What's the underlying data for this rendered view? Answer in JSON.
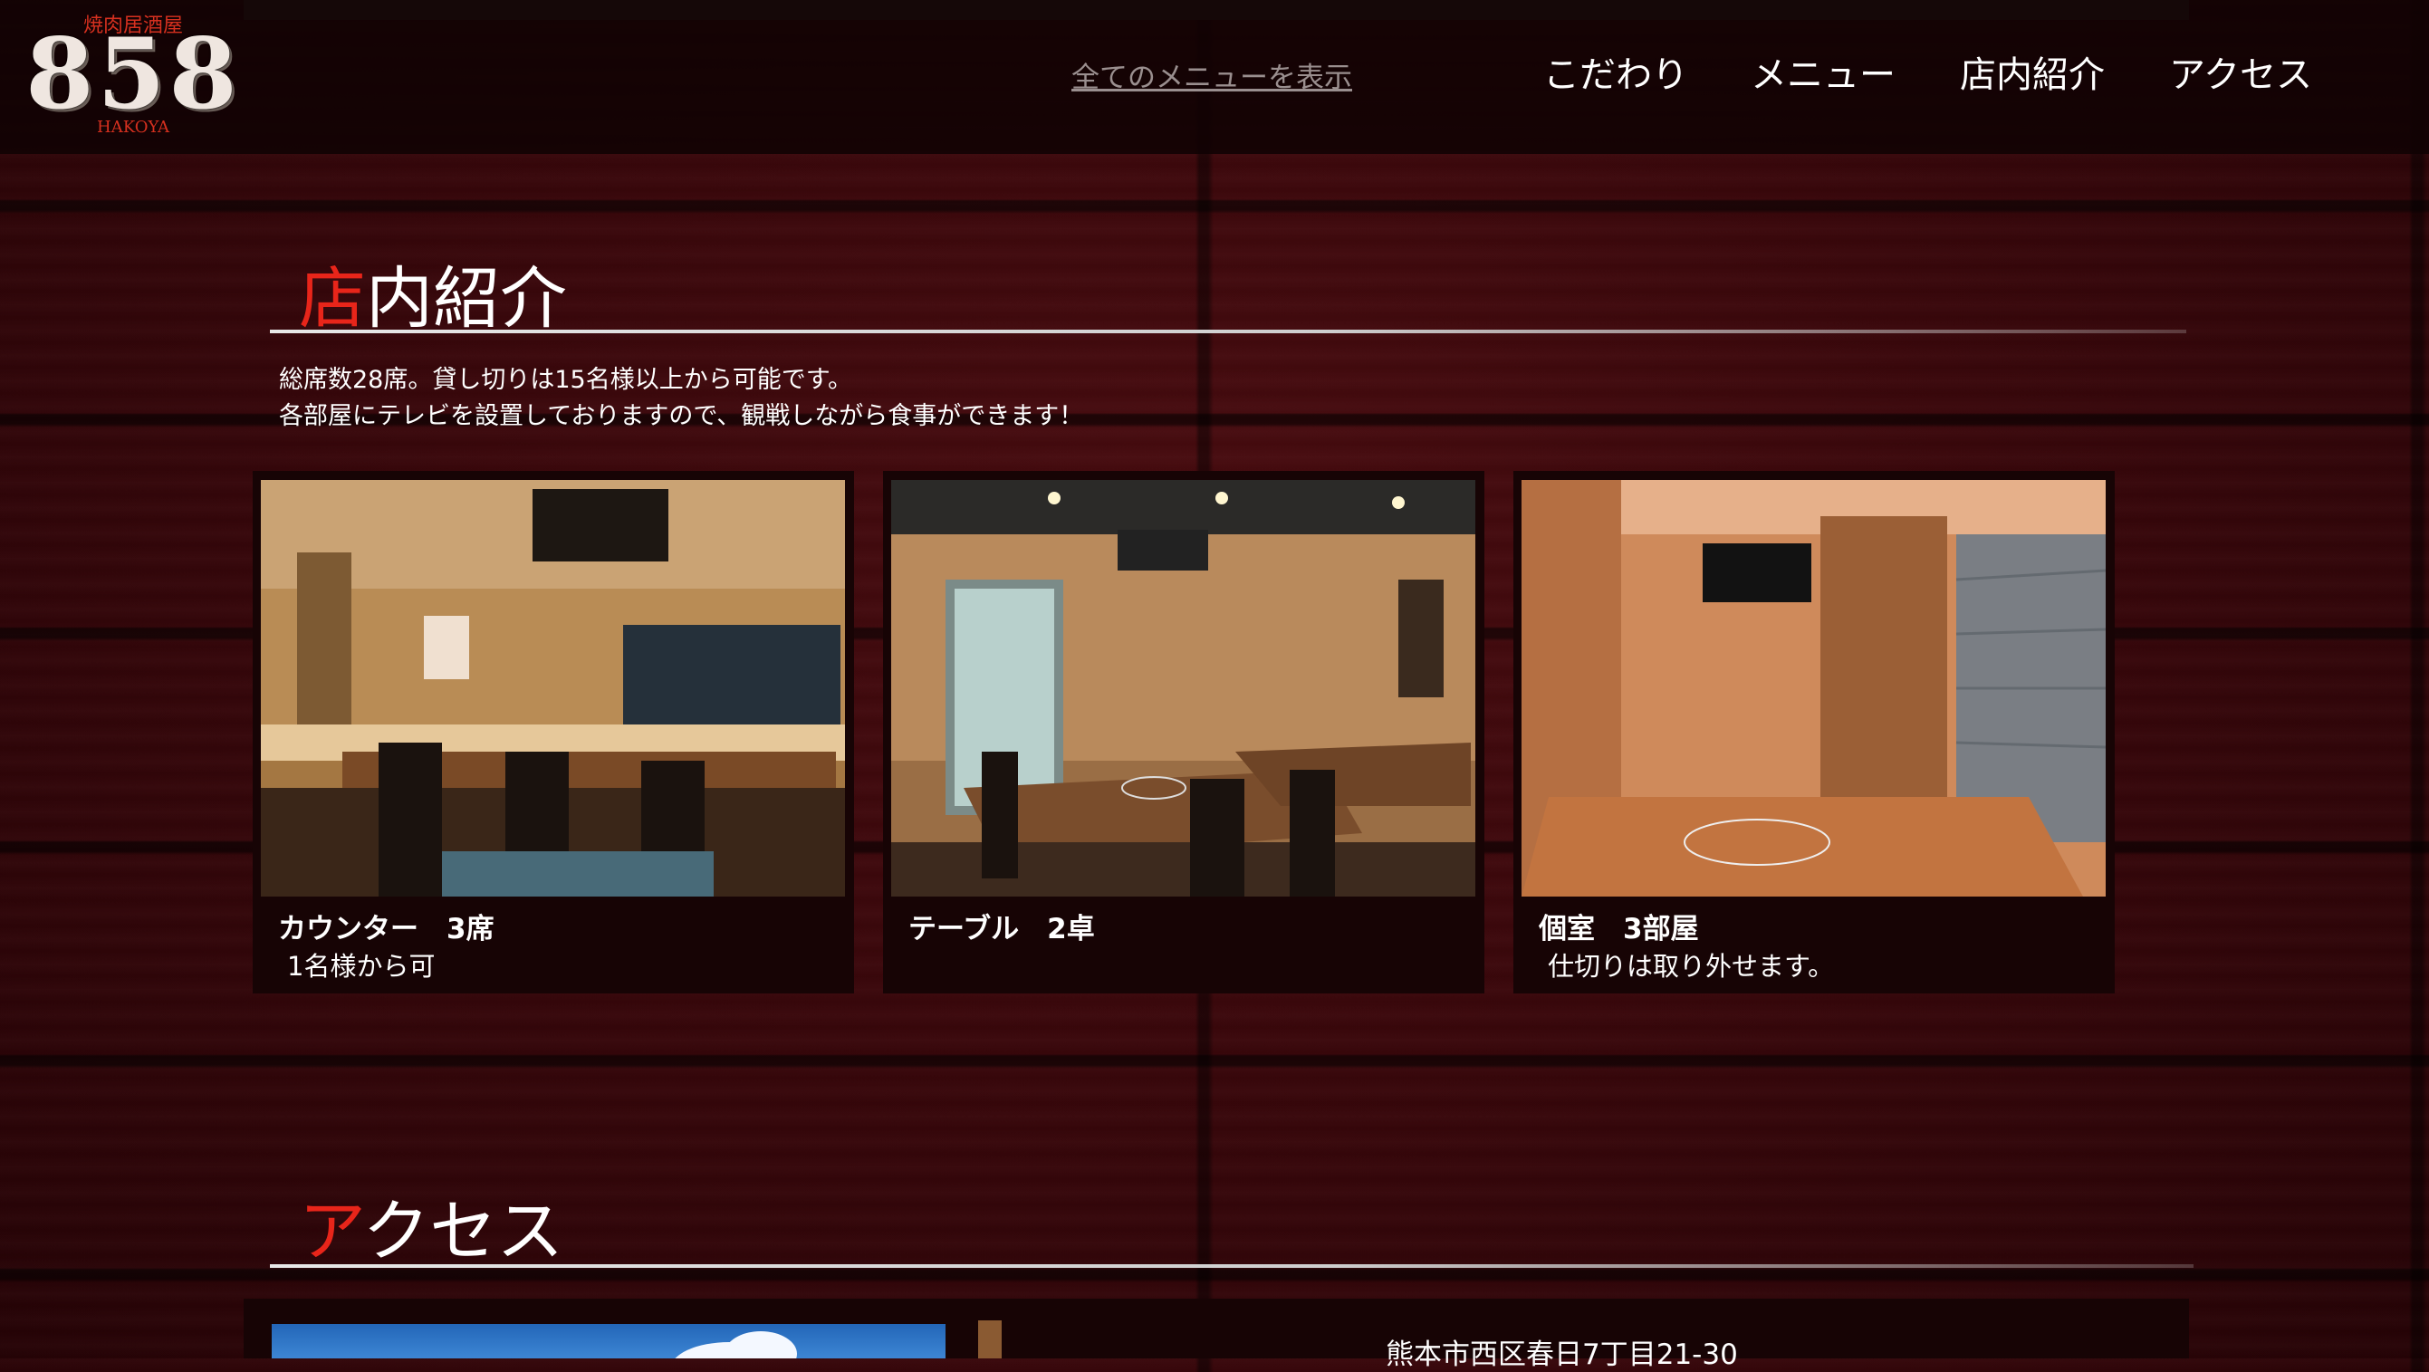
{
  "header": {
    "logo": {
      "top_text": "焼肉居酒屋",
      "number": "858",
      "bottom_text": "HAKOYA"
    },
    "all_menu_link": "全てのメニューを表示",
    "nav": [
      "こだわり",
      "メニュー",
      "店内紹介",
      "アクセス"
    ]
  },
  "intro_section": {
    "title_first": "店",
    "title_rest": "内紹介",
    "lines": [
      "総席数28席。貸し切りは15名様以上から可能です。",
      "各部屋にテレビを設置しておりますので、観戦しながら食事ができます！"
    ]
  },
  "cards": [
    {
      "title": "カウンター　3席",
      "desc": "1名様から可",
      "photo_icon": "counter-seating-photo"
    },
    {
      "title": "テーブル　2卓",
      "desc": "",
      "photo_icon": "table-seating-photo"
    },
    {
      "title": "個室　3部屋",
      "desc": "仕切りは取り外せます。",
      "photo_icon": "private-room-photo"
    }
  ],
  "access_section": {
    "title_first": "ア",
    "title_rest": "クセス",
    "address": "熊本市西区春日7丁目21-30"
  },
  "colors": {
    "accent": "#e8251a",
    "background": "#3a070b",
    "card": "#170405"
  }
}
